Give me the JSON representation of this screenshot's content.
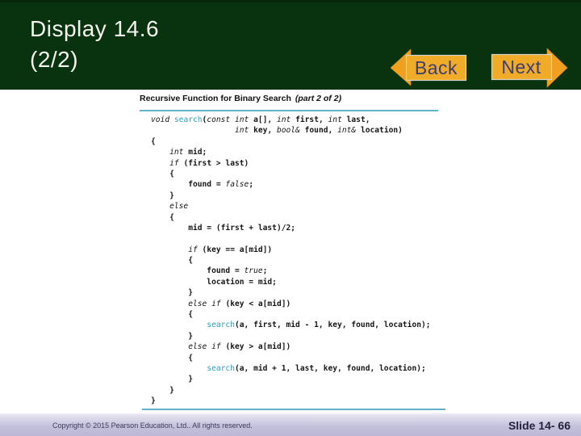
{
  "header": {
    "title_line1": "Display 14.6",
    "title_line2": "(2/2)",
    "back_label": "Back",
    "next_label": "Next"
  },
  "code_panel": {
    "title": "Recursive Function for Binary Search",
    "title_suffix": "(part 2 of 2)",
    "lines": [
      [
        [
          "k",
          "void"
        ],
        [
          "p",
          " "
        ],
        [
          "f",
          "search"
        ],
        [
          "p",
          "("
        ],
        [
          "k",
          "const"
        ],
        [
          "p",
          " "
        ],
        [
          "k",
          "int"
        ],
        [
          "p",
          " a[], "
        ],
        [
          "k",
          "int"
        ],
        [
          "p",
          " first, "
        ],
        [
          "k",
          "int"
        ],
        [
          "p",
          " last,"
        ]
      ],
      [
        [
          "p",
          "                  "
        ],
        [
          "k",
          "int"
        ],
        [
          "p",
          " key, "
        ],
        [
          "k",
          "bool&"
        ],
        [
          "p",
          " found, "
        ],
        [
          "k",
          "int&"
        ],
        [
          "p",
          " location)"
        ]
      ],
      [
        [
          "p",
          "{"
        ]
      ],
      [
        [
          "p",
          "    "
        ],
        [
          "k",
          "int"
        ],
        [
          "p",
          " mid;"
        ]
      ],
      [
        [
          "p",
          "    "
        ],
        [
          "k",
          "if"
        ],
        [
          "p",
          " (first > last)"
        ]
      ],
      [
        [
          "p",
          "    {"
        ]
      ],
      [
        [
          "p",
          "        found = "
        ],
        [
          "k",
          "false"
        ],
        [
          "p",
          ";"
        ]
      ],
      [
        [
          "p",
          "    }"
        ]
      ],
      [
        [
          "p",
          "    "
        ],
        [
          "k",
          "else"
        ]
      ],
      [
        [
          "p",
          "    {"
        ]
      ],
      [
        [
          "p",
          "        mid = (first + last)/2;"
        ]
      ],
      [
        [
          "p",
          ""
        ]
      ],
      [
        [
          "p",
          "        "
        ],
        [
          "k",
          "if"
        ],
        [
          "p",
          " (key == a[mid])"
        ]
      ],
      [
        [
          "p",
          "        {"
        ]
      ],
      [
        [
          "p",
          "            found = "
        ],
        [
          "k",
          "true"
        ],
        [
          "p",
          ";"
        ]
      ],
      [
        [
          "p",
          "            location = mid;"
        ]
      ],
      [
        [
          "p",
          "        }"
        ]
      ],
      [
        [
          "p",
          "        "
        ],
        [
          "k",
          "else"
        ],
        [
          "p",
          " "
        ],
        [
          "k",
          "if"
        ],
        [
          "p",
          " (key < a[mid])"
        ]
      ],
      [
        [
          "p",
          "        {"
        ]
      ],
      [
        [
          "p",
          "            "
        ],
        [
          "f",
          "search"
        ],
        [
          "p",
          "(a, first, mid - 1, key, found, location);"
        ]
      ],
      [
        [
          "p",
          "        }"
        ]
      ],
      [
        [
          "p",
          "        "
        ],
        [
          "k",
          "else"
        ],
        [
          "p",
          " "
        ],
        [
          "k",
          "if"
        ],
        [
          "p",
          " (key > a[mid])"
        ]
      ],
      [
        [
          "p",
          "        {"
        ]
      ],
      [
        [
          "p",
          "            "
        ],
        [
          "f",
          "search"
        ],
        [
          "p",
          "(a, mid + 1, last, key, found, location);"
        ]
      ],
      [
        [
          "p",
          "        }"
        ]
      ],
      [
        [
          "p",
          "    }"
        ]
      ],
      [
        [
          "p",
          "}"
        ]
      ]
    ]
  },
  "footer": {
    "copyright": "Copyright © 2015 Pearson Education, Ltd..  All rights reserved.",
    "slide_label": "Slide 14- 66"
  },
  "colors": {
    "header_bg": "#09320F",
    "button_gold": "#F0A828",
    "button_text": "#3D3D72",
    "accent_teal": "#5FB2CA",
    "code_function": "#2C9EBF",
    "footer_lavender": "#C4C1DC"
  }
}
